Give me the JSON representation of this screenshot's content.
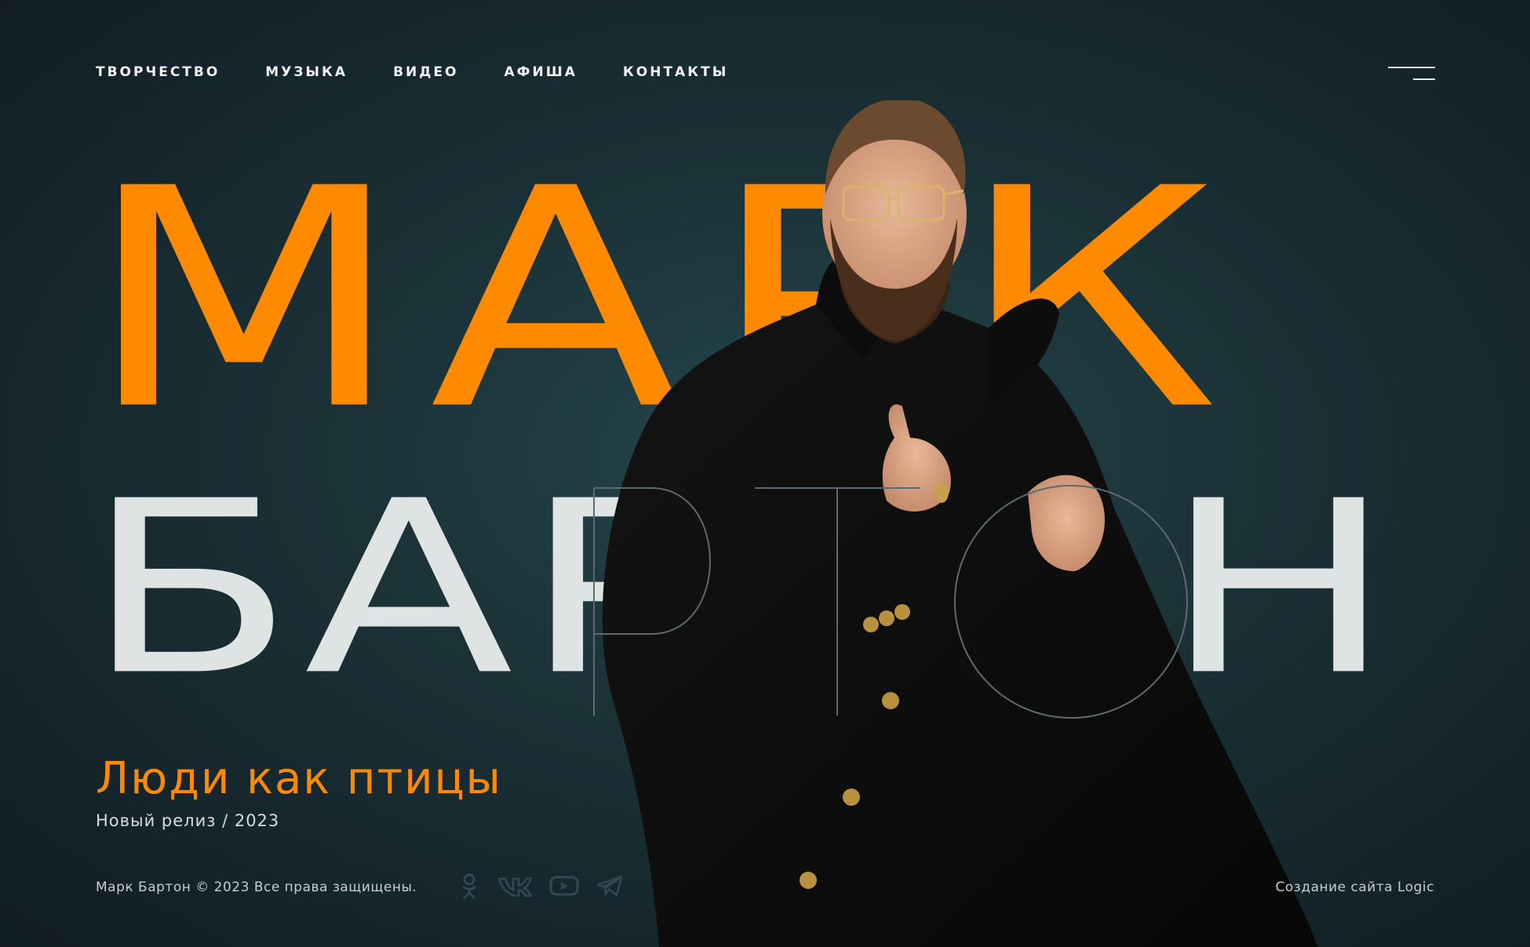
{
  "nav": {
    "items": [
      "ТВОРЧЕСТВО",
      "МУЗЫКА",
      "ВИДЕО",
      "АФИША",
      "КОНТАКТЫ"
    ]
  },
  "hero": {
    "first_name": "МАРК",
    "last_name": "БАРТОН"
  },
  "release": {
    "title": "Люди как птицы",
    "subtitle": "Новый релиз / 2023"
  },
  "footer": {
    "copyright": "Марк Бартон © 2023 Все права защищены.",
    "credits": "Создание сайта Logic",
    "socials": [
      "odnoklassniki-icon",
      "vk-icon",
      "youtube-icon",
      "telegram-icon"
    ]
  },
  "colors": {
    "accent": "#ff8a00",
    "light": "#dfe3e4",
    "background": "#1b3237"
  }
}
